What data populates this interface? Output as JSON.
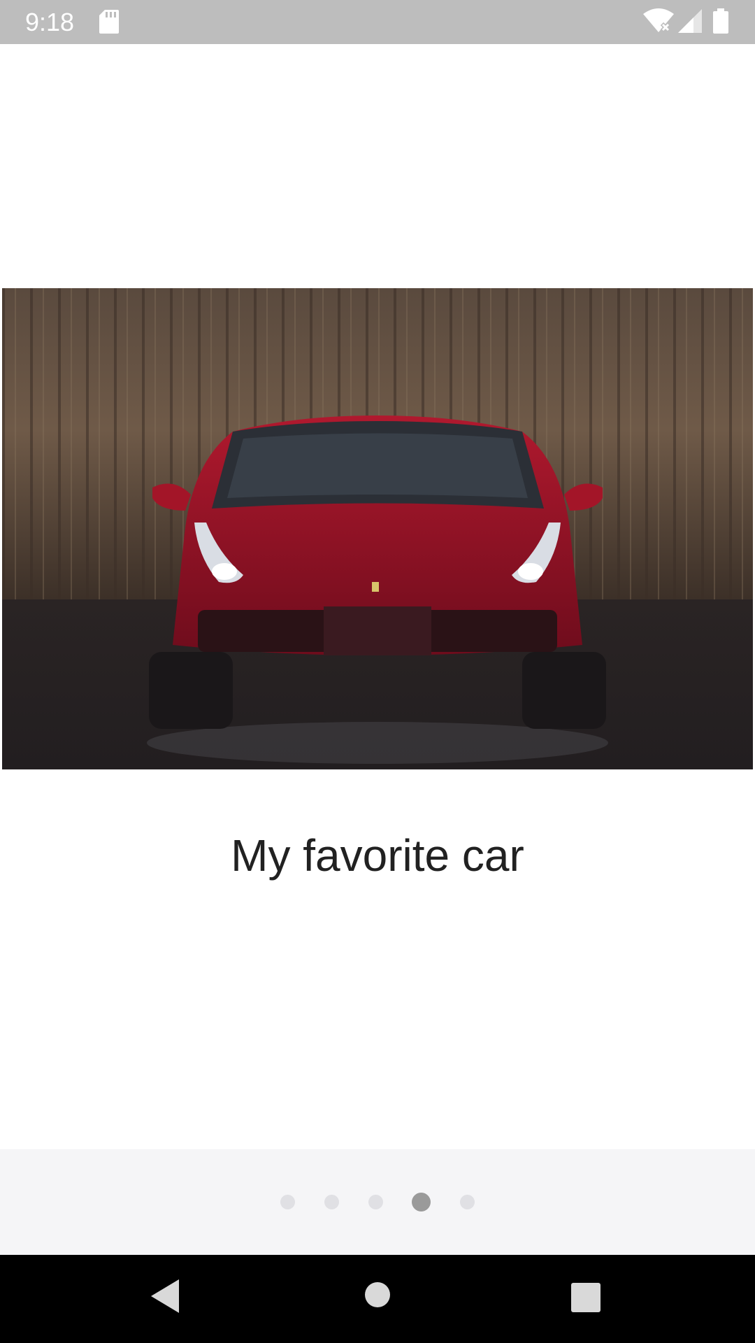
{
  "status_bar": {
    "time": "9:18",
    "icons": [
      "sd-card-icon",
      "wifi-no-internet-icon",
      "cell-signal-icon",
      "battery-icon"
    ]
  },
  "main": {
    "image_alt": "Red sports car in front of a corrugated wall",
    "caption": "My favorite car"
  },
  "pager": {
    "total_pages": 5,
    "current_page": 4,
    "active_color": "#9a9a9a",
    "inactive_color": "#e0e0e4"
  },
  "nav_bar": {
    "icons": [
      "back-icon",
      "home-icon",
      "recents-icon"
    ]
  }
}
